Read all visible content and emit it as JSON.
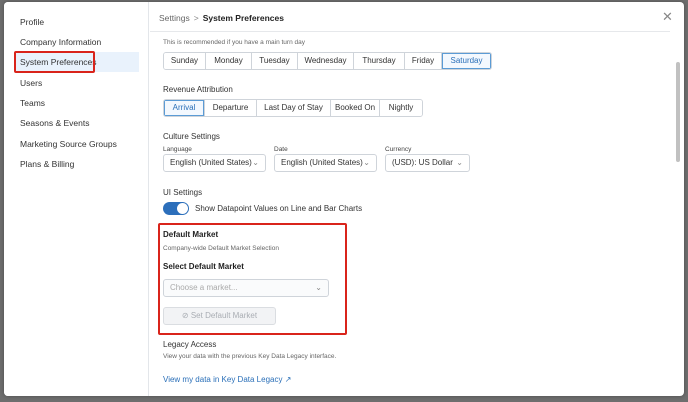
{
  "sidebar": {
    "items": [
      {
        "label": "Profile"
      },
      {
        "label": "Company Information"
      },
      {
        "label": "System Preferences"
      },
      {
        "label": "Users"
      },
      {
        "label": "Teams"
      },
      {
        "label": "Seasons & Events"
      },
      {
        "label": "Marketing Source Groups"
      },
      {
        "label": "Plans & Billing"
      }
    ],
    "active_index": 2
  },
  "header": {
    "breadcrumb_root": "Settings",
    "breadcrumb_sep": ">",
    "breadcrumb_current": "System Preferences",
    "close_icon": "close-icon"
  },
  "week_start": {
    "hint": "This is recommended if you have a main turn day",
    "days": [
      "Sunday",
      "Monday",
      "Tuesday",
      "Wednesday",
      "Thursday",
      "Friday",
      "Saturday"
    ],
    "selected": "Saturday"
  },
  "revenue_attribution": {
    "title": "Revenue Attribution",
    "options": [
      "Arrival",
      "Departure",
      "Last Day of Stay",
      "Booked On",
      "Nightly"
    ],
    "selected": "Arrival"
  },
  "culture": {
    "title": "Culture Settings",
    "language_label": "Language",
    "language_value": "English (United States)",
    "date_label": "Date",
    "date_value": "English (United States)",
    "currency_label": "Currency",
    "currency_value": "(USD): US Dollar"
  },
  "ui_settings": {
    "title": "UI Settings",
    "toggle_label": "Show Datapoint Values on Line and Bar Charts",
    "toggle_on": true
  },
  "default_market": {
    "title": "Default Market",
    "hint": "Company-wide Default Market Selection",
    "select_label": "Select Default Market",
    "placeholder": "Choose a market...",
    "button_label": "Set Default Market"
  },
  "legacy": {
    "title": "Legacy Access",
    "hint": "View your data with the previous Key Data Legacy interface.",
    "link": "View my data in Key Data Legacy"
  },
  "colors": {
    "accent": "#2c6fbb",
    "highlight": "#d9241b"
  }
}
